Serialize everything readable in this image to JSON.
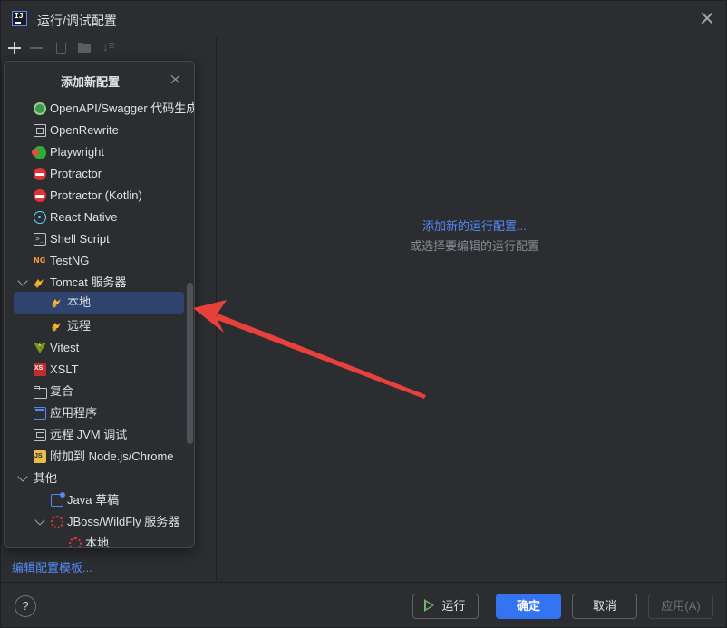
{
  "window": {
    "title": "运行/调试配置",
    "logo_text": "IJ"
  },
  "toolbar": {
    "buttons": [
      "add",
      "remove",
      "copy",
      "folder",
      "sort"
    ]
  },
  "popup": {
    "title": "添加新配置",
    "items": [
      {
        "label": "OpenAPI/Swagger 代码生成",
        "icon": "openapi-icon"
      },
      {
        "label": "OpenRewrite",
        "icon": "openrewrite-icon"
      },
      {
        "label": "Playwright",
        "icon": "playwright-icon"
      },
      {
        "label": "Protractor",
        "icon": "protractor-icon"
      },
      {
        "label": "Protractor (Kotlin)",
        "icon": "protractor-icon"
      },
      {
        "label": "React Native",
        "icon": "react-icon"
      },
      {
        "label": "Shell Script",
        "icon": "shell-script-icon"
      },
      {
        "label": "TestNG",
        "icon": "testng-icon"
      },
      {
        "label": "Tomcat 服务器",
        "icon": "tomcat-icon",
        "expanded": true
      },
      {
        "label": "本地",
        "icon": "tomcat-icon",
        "selected": true
      },
      {
        "label": "远程",
        "icon": "tomcat-icon"
      },
      {
        "label": "Vitest",
        "icon": "vitest-icon"
      },
      {
        "label": "XSLT",
        "icon": "xslt-icon"
      },
      {
        "label": "复合",
        "icon": "compound-icon"
      },
      {
        "label": "应用程序",
        "icon": "application-icon"
      },
      {
        "label": "远程 JVM 调试",
        "icon": "remote-jvm-icon"
      },
      {
        "label": "附加到 Node.js/Chrome",
        "icon": "nodejs-icon"
      },
      {
        "label": "其他",
        "expanded": true
      },
      {
        "label": "Java 草稿",
        "icon": "java-scratch-icon"
      },
      {
        "label": "JBoss/WildFly 服务器",
        "icon": "jboss-icon",
        "expanded": true
      },
      {
        "label": "本地",
        "icon": "jboss-icon"
      }
    ]
  },
  "left_footer": {
    "edit_templates": "编辑配置模板..."
  },
  "right": {
    "add_new_link": "添加新的运行配置...",
    "hint": "或选择要编辑的运行配置"
  },
  "footer": {
    "help": "?",
    "run": "运行",
    "ok": "确定",
    "cancel": "取消",
    "apply": "应用(A)"
  },
  "colors": {
    "background": "#2b2d30",
    "accent": "#3574f0",
    "link": "#548af7",
    "selection": "#2e436e",
    "annotation_arrow": "#e8403a"
  }
}
